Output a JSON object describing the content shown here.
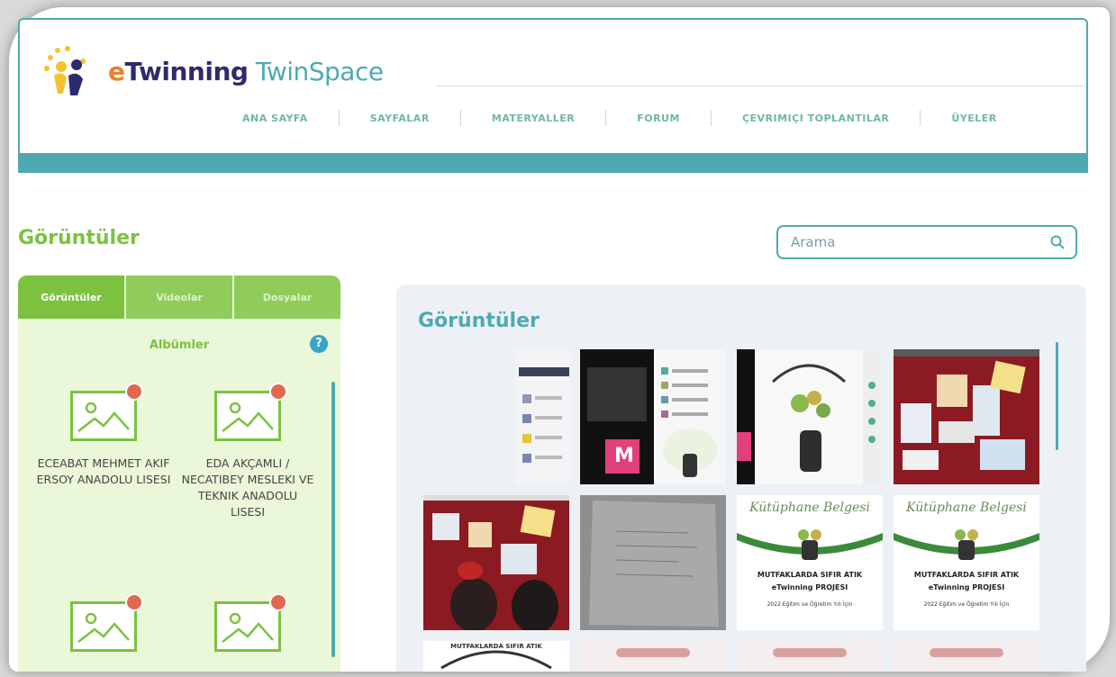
{
  "logo": {
    "part1": "e",
    "part2": "Twinning",
    "part3": "TwinSpace"
  },
  "nav": [
    {
      "label": "ANA SAYFA"
    },
    {
      "label": "SAYFALAR"
    },
    {
      "label": "MATERYALLER"
    },
    {
      "label": "FORUM"
    },
    {
      "label": "ÇEVRIMIÇI TOPLANTILAR"
    },
    {
      "label": "ÜYELER"
    }
  ],
  "page_title": "Görüntüler",
  "search": {
    "placeholder": "Arama"
  },
  "left_tabs": [
    {
      "label": "Görüntüler",
      "active": true
    },
    {
      "label": "Videolar",
      "active": false
    },
    {
      "label": "Dosyalar",
      "active": false
    }
  ],
  "albums_title": "Albümler",
  "help_glyph": "?",
  "albums": [
    {
      "name": "ECEABAT MEHMET AKIF ERSOY ANADOLU LISESI"
    },
    {
      "name": "EDA AKÇAMLI / NECATIBEY MESLEKI VE TEKNIK ANADOLU LISESI"
    },
    {
      "name": ""
    },
    {
      "name": ""
    }
  ],
  "gallery_title": "Görüntüler",
  "thumbnails": {
    "meeting_avatar": "M",
    "poster_title": "Kütüphane Belgesi",
    "poster_line1": "MUTFAKLARDA SIFIR ATIK",
    "poster_line2": "eTwinning PROJESI",
    "poster_line3": "2022 Eğitim ve Öğretim Yılı İçin",
    "poster_header_arc": "MUTFAKLARDA SIFIR ATIK"
  },
  "colors": {
    "teal": "#4fa9b3",
    "green": "#7cc23f",
    "orange": "#ee7f2d",
    "navy": "#2f2a6e"
  }
}
